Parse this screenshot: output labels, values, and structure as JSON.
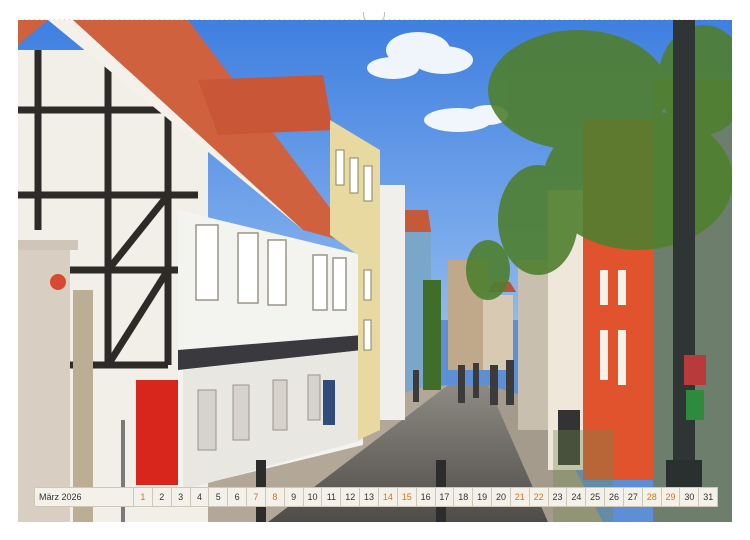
{
  "calendar": {
    "month": "März",
    "year": "2026",
    "weekend_color": "#d4731b",
    "days": [
      {
        "n": "1",
        "we": true
      },
      {
        "n": "2",
        "we": false
      },
      {
        "n": "3",
        "we": false
      },
      {
        "n": "4",
        "we": false
      },
      {
        "n": "5",
        "we": false
      },
      {
        "n": "6",
        "we": false
      },
      {
        "n": "7",
        "we": true
      },
      {
        "n": "8",
        "we": true
      },
      {
        "n": "9",
        "we": false
      },
      {
        "n": "10",
        "we": false
      },
      {
        "n": "11",
        "we": false
      },
      {
        "n": "12",
        "we": false
      },
      {
        "n": "13",
        "we": false
      },
      {
        "n": "14",
        "we": true
      },
      {
        "n": "15",
        "we": true
      },
      {
        "n": "16",
        "we": false
      },
      {
        "n": "17",
        "we": false
      },
      {
        "n": "18",
        "we": false
      },
      {
        "n": "19",
        "we": false
      },
      {
        "n": "20",
        "we": false
      },
      {
        "n": "21",
        "we": true
      },
      {
        "n": "22",
        "we": true
      },
      {
        "n": "23",
        "we": false
      },
      {
        "n": "24",
        "we": false
      },
      {
        "n": "25",
        "we": false
      },
      {
        "n": "26",
        "we": false
      },
      {
        "n": "27",
        "we": false
      },
      {
        "n": "28",
        "we": true
      },
      {
        "n": "29",
        "we": true
      },
      {
        "n": "30",
        "we": false
      },
      {
        "n": "31",
        "we": false
      }
    ]
  },
  "photo": {
    "sky_color": "#5c8fd6",
    "roof_color": "#d0613e",
    "facade_red": "#e0532d",
    "door_red": "#d8261c"
  }
}
